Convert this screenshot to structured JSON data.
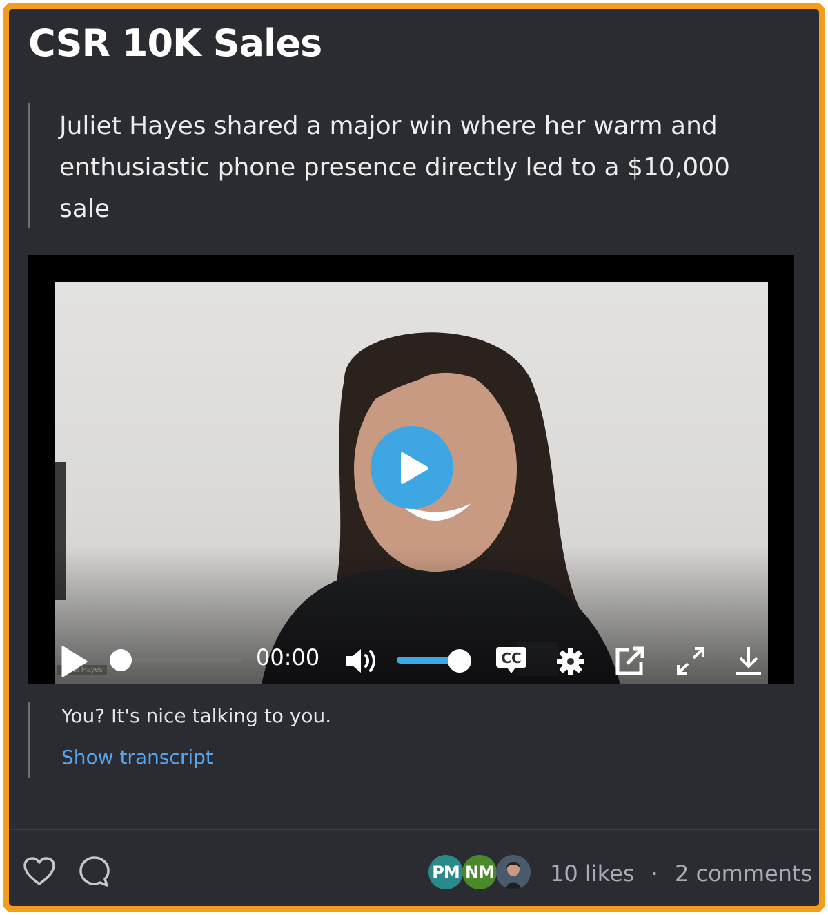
{
  "post": {
    "title": "CSR 10K Sales",
    "summary": "Juliet Hayes shared a major win where her warm and enthusiastic phone presence directly led to a $10,000 sale"
  },
  "video": {
    "current_time": "00:00",
    "progress": 0,
    "volume": 1.0,
    "controls": [
      "play-icon",
      "volume-icon",
      "captions-icon",
      "settings-icon",
      "open-external-icon",
      "fullscreen-icon",
      "download-icon"
    ],
    "accent_color": "#3fa6e4"
  },
  "transcript": {
    "caption": "You? It's nice talking to you.",
    "show_label": "Show transcript"
  },
  "footer": {
    "avatars": [
      {
        "initials": "PM",
        "color": "#2a8a8a"
      },
      {
        "initials": "NM",
        "color": "#4a8a2a"
      },
      {
        "initials": "",
        "color": "#3a4a5a"
      }
    ],
    "likes": "10 likes",
    "separator": "·",
    "comments": "2 comments"
  },
  "theme": {
    "border": "#f39c1e",
    "background": "#2a2c31",
    "link": "#5aa4ec"
  }
}
